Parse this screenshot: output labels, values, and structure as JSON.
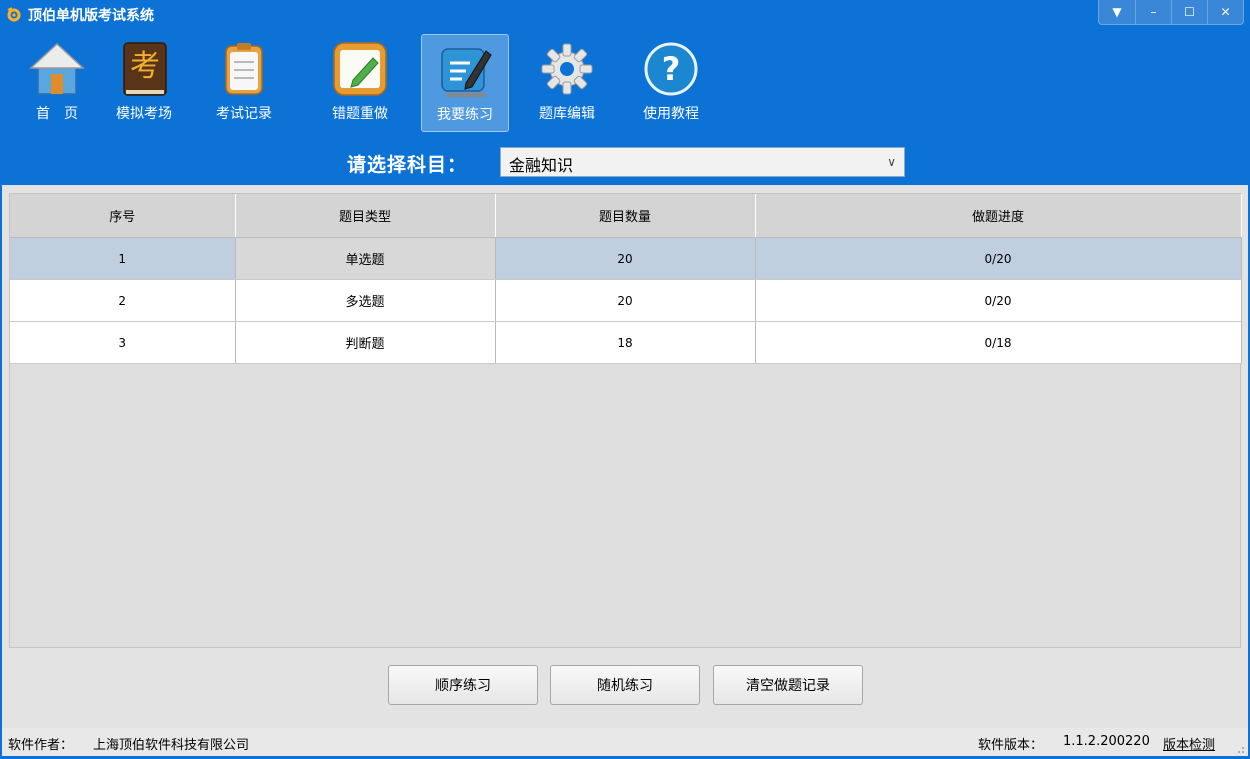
{
  "window": {
    "title": "顶伯单机版考试系统",
    "controls": [
      "menu-arrow-icon",
      "minimize-icon",
      "maximize-icon",
      "close-icon"
    ]
  },
  "toolbar": {
    "items": [
      {
        "label": "首　页",
        "icon": "home-icon",
        "active": false
      },
      {
        "label": "模拟考场",
        "icon": "exam-book-icon",
        "active": false
      },
      {
        "label": "考试记录",
        "icon": "clipboard-icon",
        "active": false
      },
      {
        "label": "错题重做",
        "icon": "notepad-pencil-icon",
        "active": false
      },
      {
        "label": "我要练习",
        "icon": "practice-pen-icon",
        "active": true
      },
      {
        "label": "题库编辑",
        "icon": "gear-icon",
        "active": false
      },
      {
        "label": "使用教程",
        "icon": "help-icon",
        "active": false
      }
    ]
  },
  "subject": {
    "label": "请选择科目：",
    "selected": "金融知识"
  },
  "table": {
    "headers": [
      "序号",
      "题目类型",
      "题目数量",
      "做题进度"
    ],
    "rows": [
      {
        "index": "1",
        "type": "单选题",
        "count": "20",
        "progress": "0/20",
        "selected": true
      },
      {
        "index": "2",
        "type": "多选题",
        "count": "20",
        "progress": "0/20",
        "selected": false
      },
      {
        "index": "3",
        "type": "判断题",
        "count": "18",
        "progress": "0/18",
        "selected": false
      }
    ]
  },
  "actions": {
    "sequential": "顺序练习",
    "random": "随机练习",
    "clear": "清空做题记录"
  },
  "status": {
    "author_label": "软件作者：",
    "author": "上海顶伯软件科技有限公司",
    "version_label": "软件版本：",
    "version": "1.1.2.200220",
    "check_update": "版本检测"
  },
  "colors": {
    "accent": "#0c72d6",
    "selected_row": "#bfcfe0"
  }
}
